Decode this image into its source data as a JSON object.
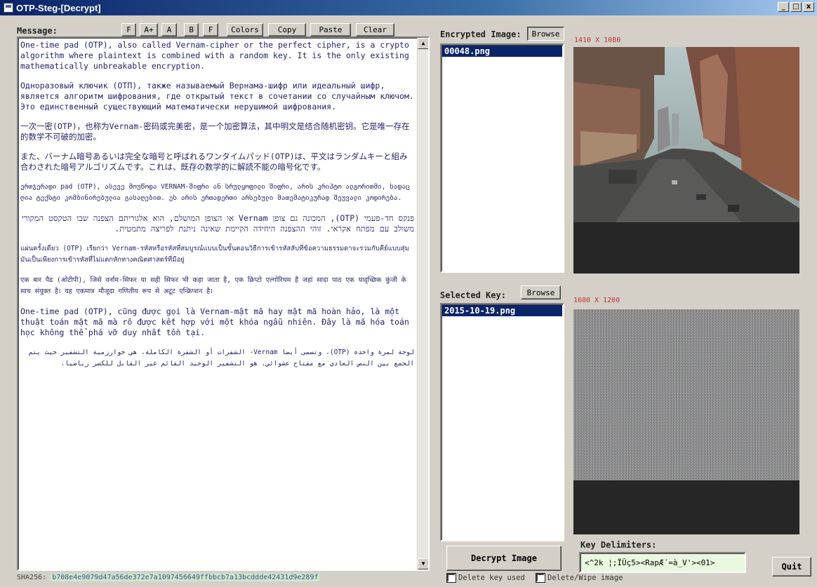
{
  "window": {
    "title": "OTP-Steg-[Decrypt]",
    "controls": [
      "_",
      "□",
      "x"
    ]
  },
  "message": {
    "label": "Message:",
    "toolbar": [
      "F",
      "A+",
      "A",
      "B",
      "F",
      "Colors",
      "Copy",
      "Paste",
      "Clear"
    ],
    "paragraphs": [
      "One-time pad (OTP), also called Vernam-cipher or the perfect cipher, is a crypto algorithm where plaintext is combined with a random key. It is the only existing mathematically unbreakable encryption.",
      "Одноразовый ключик (ОТП), также называемый Вернама-шифр или идеальный шифр, является алгоритм шифрования, где открытый текст в сочетании со случайным ключом. Это единственный существующий математически нерушимой шифрования.",
      "一次一密(OTP)，也称为Vernam-密码或完美密，是一个加密算法，其中明文是结合随机密钥。它是唯一存在的数学不可破的加密。",
      "また、バーナム暗号あるいは完全な暗号と呼ばれるワンタイムパッド(OTP)は、平文はランダムキーと組み合わされた暗号アルゴリズムです。これは、既存の数学的に解読不能の暗号化です。",
      "ერთჯერადი pad (OTP), ასევე მოუწოდა VERNAM-შიფრი ან სრულყოფილი შიფრი, არის კრიპტო ალგორითმი, სადაც ღია ტექსტი კომბინირებულია გასაღებით. ეს არის ერთადერთი არსებული მათემატიკურად შეუვალი კოდირება.",
      "פנקס חד-פעמי (OTP), המכונה גם צופן Vernam או הצופן המושלם, הוא אלגוריתם הצפנה שבו הטקסט המקורי משולב עם מפתח אקראי. זוהי ההצפנה היחידה הקיימת שאינה ניתנת לפריצה מתמטית.",
      "แผ่นครั้งเดียว (OTP) เรียกว่า Vernam-รหัสหรือรหัสที่สมบูรณ์แบบเป็นขั้นตอนวิธีการเข้ารหัสลับที่ข้อความธรรมดาจะรวมกับคีย์แบบสุ่ม มันเป็นเพียงการเข้ารหัสที่ไม่แตกหักทางคณิตศาสตร์ที่มีอยู่",
      "एक बार पैड (ओटीपी), जिसे वर्नाम-सिफर या सही सिफर भी कहा जाता है, एक क्रिप्टो एल्गोरिथम है जहां सादा पाठ एक यादृच्छिक कुंजी के साथ संयुक्त है। यह एकमात्र मौजूदा गणितीय रूप से अटूट एन्क्रिप्शन है।",
      "One-time pad (OTP), cũng được gọi là Vernam-mật mã hay mật mã hoàn hảo, là một thuật toán mật mã mà rõ được kết hợp với một khóa ngẫu nhiên. Đây là mã hóa toán học không thể phá vỡ duy nhất tồn tại.",
      "لوحة لمرة واحدة (OTP)، وتسمى أيضا Vernam- الشفرات أو الشفرة الكاملة، هي خوارزمية التشفير حيث يتم الجمع بين النص العادي مع مفتاح عشوائي. هو التشفير الوحيد القائم غير القابل للكسر رياضيا."
    ],
    "sha_label": "SHA256:",
    "sha_value": "b708e4e9079d47a56de372e7a1097456649ffbbcb7a13bcddde42431d9e289f"
  },
  "encrypted": {
    "label": "Encrypted Image:",
    "browse": "Browse",
    "files": [
      "00048.png"
    ],
    "dimensions": "1410 X 1080"
  },
  "key": {
    "label": "Selected Key:",
    "browse": "Browse",
    "files": [
      "2015-10-19.png"
    ],
    "dimensions": "1600 X 1200"
  },
  "actions": {
    "decrypt": "Decrypt Image",
    "quit": "Quit",
    "delete_key": "Delete key used",
    "delete_image": "Delete/Wipe image"
  },
  "delimiters": {
    "label": "Key Delimiters:",
    "value": "<^2k ¦;ÏÛç5><RapÆ´=à_V'><01>"
  },
  "colors": {
    "titlebar": "#0a246a",
    "selection": "#0a246a",
    "message_text": "#24246c",
    "dimension_text": "#c03030",
    "delimiter_bg": "#eaf8df"
  }
}
